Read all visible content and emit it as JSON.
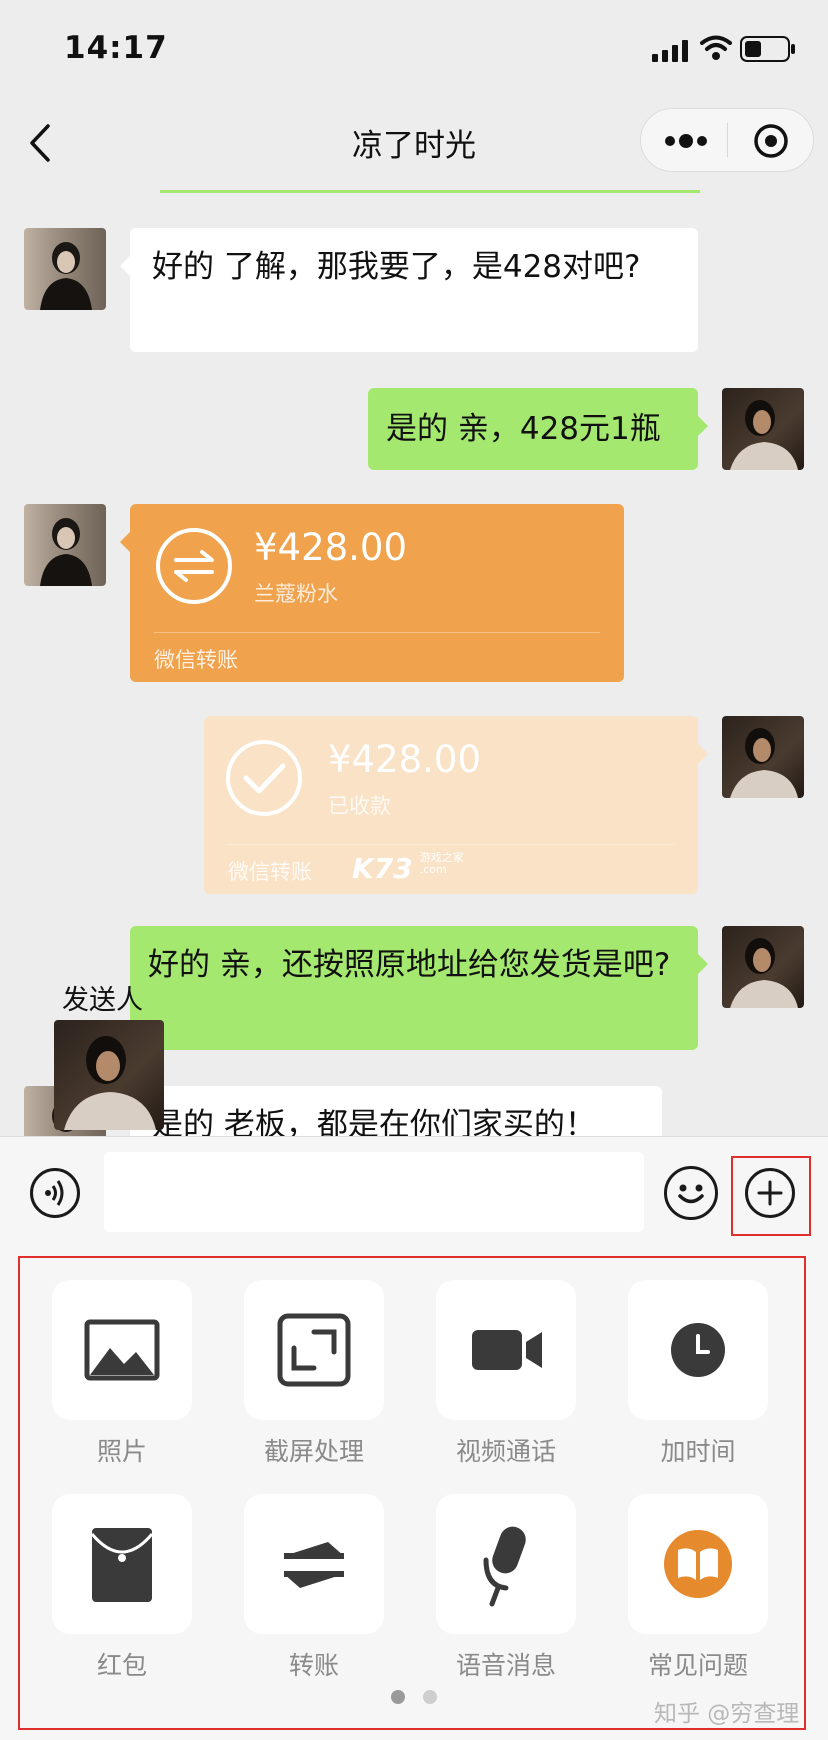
{
  "status_bar": {
    "time": "14:17"
  },
  "nav": {
    "title": "凉了时光"
  },
  "messages": {
    "m1": "好的 了解，那我要了，是428对吧?",
    "m2": "是的 亲，428元1瓶",
    "transfer_sent": {
      "amount": "¥428.00",
      "note": "兰蔻粉水",
      "footer": "微信转账"
    },
    "transfer_received": {
      "amount": "¥428.00",
      "status": "已收款",
      "footer": "微信转账"
    },
    "m3": "好的 亲，还按照原地址给您发货是吧?",
    "m4": "是的 老板，都是在你们家买的！",
    "sender_label": "发送人"
  },
  "watermark_site": {
    "main": "K73",
    "sub1": "游戏之家",
    "sub2": ".com"
  },
  "input": {
    "placeholder": ""
  },
  "panel": {
    "items": [
      {
        "label": "照片",
        "icon": "image-icon"
      },
      {
        "label": "截屏处理",
        "icon": "screenshot-icon"
      },
      {
        "label": "视频通话",
        "icon": "video-camera-icon"
      },
      {
        "label": "加时间",
        "icon": "clock-icon"
      },
      {
        "label": "红包",
        "icon": "red-packet-icon"
      },
      {
        "label": "转账",
        "icon": "transfer-icon"
      },
      {
        "label": "语音消息",
        "icon": "microphone-icon"
      },
      {
        "label": "常见问题",
        "icon": "book-icon"
      }
    ]
  },
  "watermark": "知乎 @穷查理",
  "colors": {
    "bubble_green": "#a4e86f",
    "transfer_orange": "#f0a24c",
    "transfer_received": "#f9e2c5",
    "highlight_red": "#e02e2e",
    "faq_orange": "#e68a2e"
  }
}
